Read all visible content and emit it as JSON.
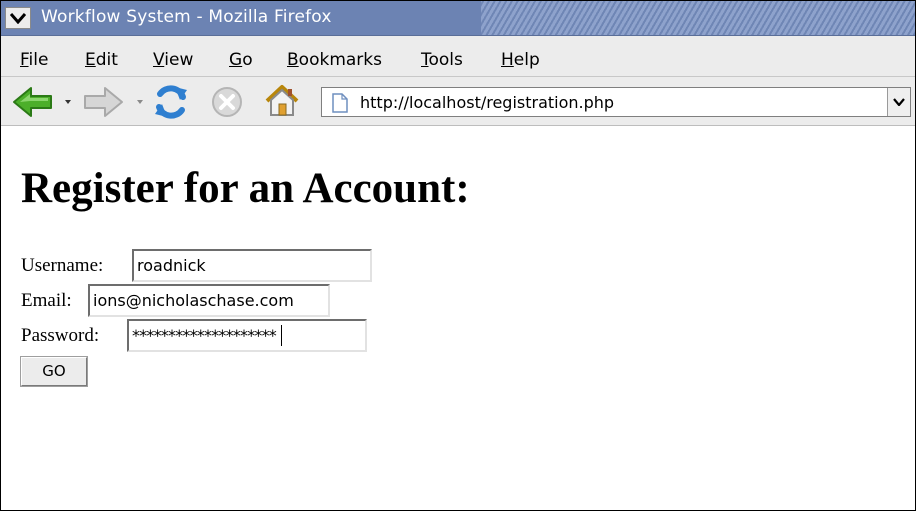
{
  "window": {
    "title": "Workflow System - Mozilla Firefox"
  },
  "menu": {
    "items": [
      {
        "label": "File",
        "accel": "F"
      },
      {
        "label": "Edit",
        "accel": "E"
      },
      {
        "label": "View",
        "accel": "V"
      },
      {
        "label": "Go",
        "accel": "G"
      },
      {
        "label": "Bookmarks",
        "accel": "B"
      },
      {
        "label": "Tools",
        "accel": "T"
      },
      {
        "label": "Help",
        "accel": "H"
      }
    ]
  },
  "toolbar": {
    "icons": [
      "back-arrow-icon",
      "forward-arrow-icon",
      "reload-icon",
      "stop-icon",
      "home-icon"
    ],
    "url": "http://localhost/registration.php"
  },
  "page": {
    "heading": "Register for an Account:",
    "form": {
      "username_label": "Username:",
      "username_value": "roadnick",
      "email_label": "Email:",
      "email_value": "ions@nicholaschase.com",
      "password_label": "Password:",
      "password_mask": "********************",
      "submit_label": "GO"
    }
  },
  "colors": {
    "titlebar": "#6c83b3",
    "chrome": "#ececec",
    "back_arrow": "#4caf2a",
    "reload": "#2f7fd0"
  }
}
